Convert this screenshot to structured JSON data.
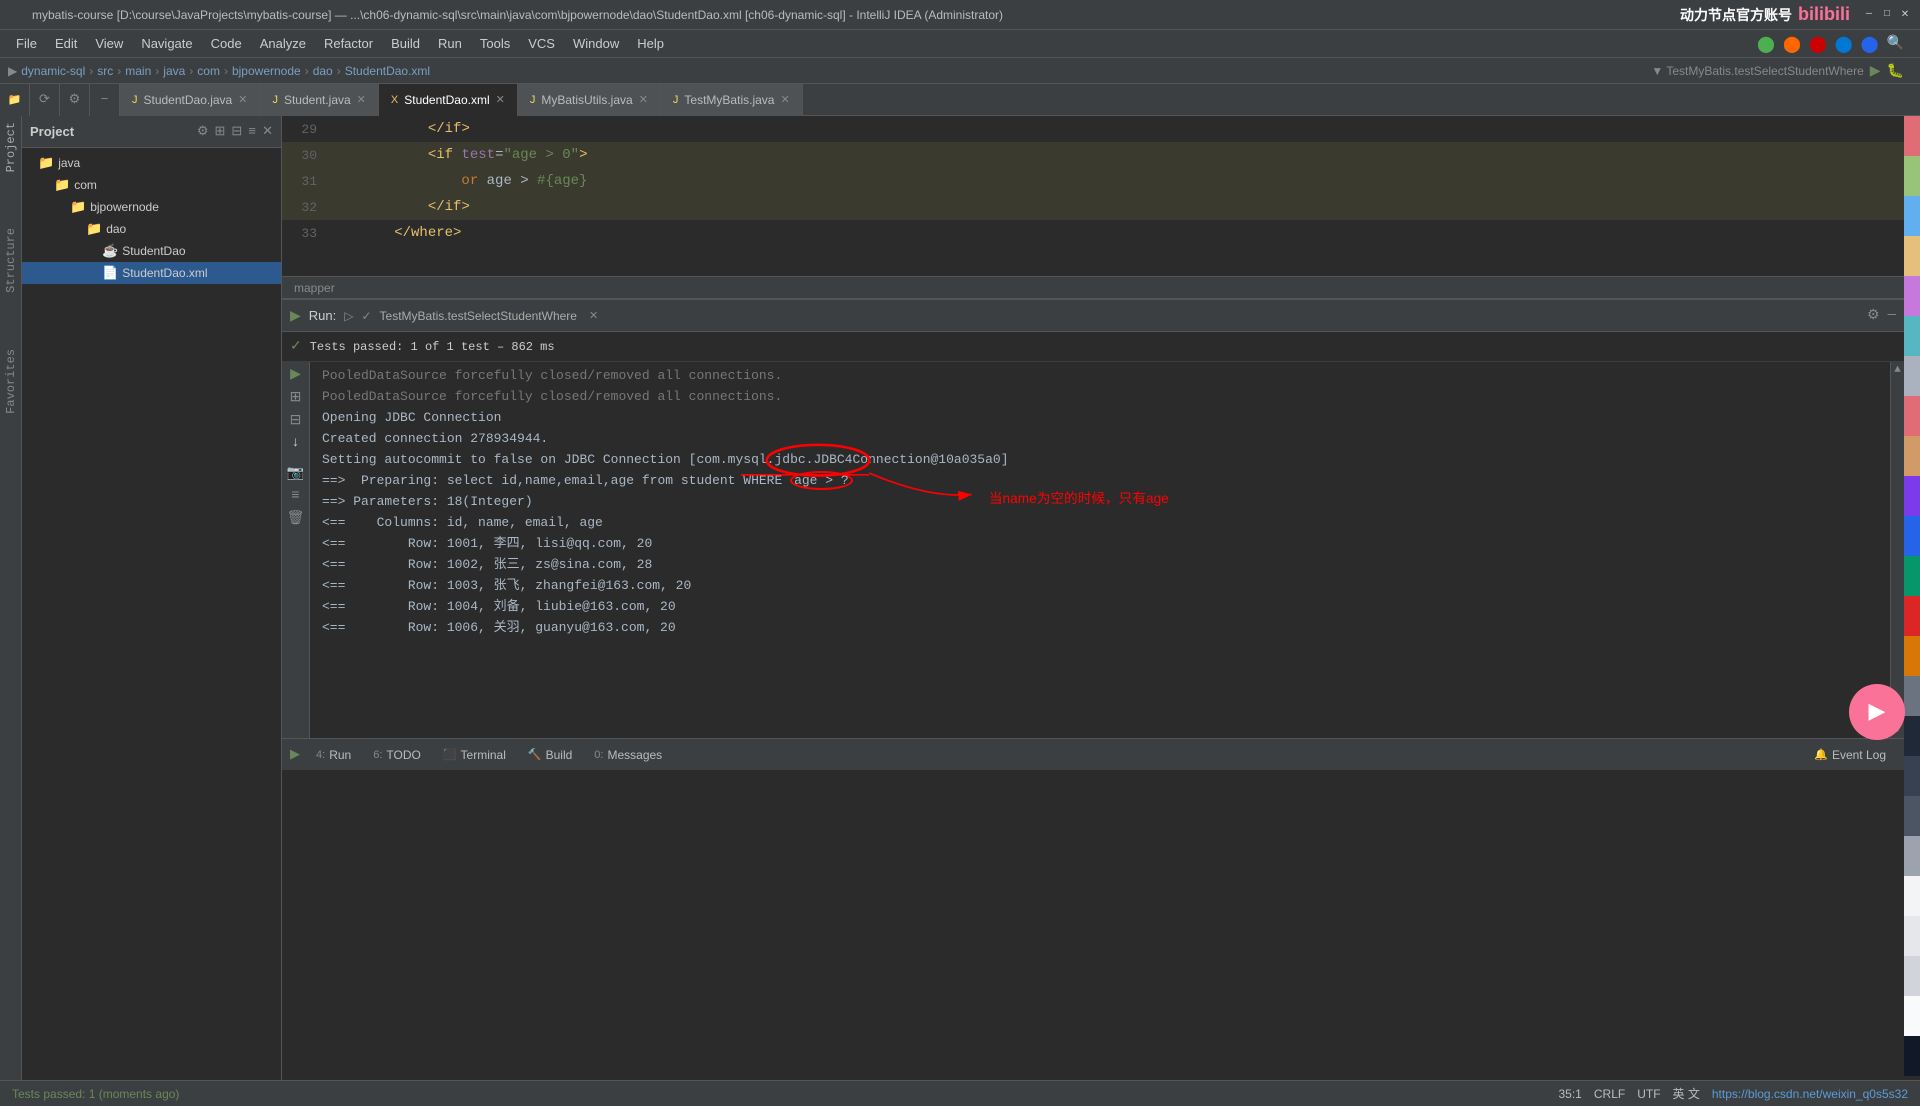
{
  "titlebar": {
    "title": "mybatis-course [D:\\course\\JavaProjects\\mybatis-course] — ...\\ch06-dynamic-sql\\src\\main\\java\\com\\bjpowernode\\dao\\StudentDao.xml [ch06-dynamic-sql] - IntelliJ IDEA (Administrator)",
    "bilibili_brand": "动力节点官方账号",
    "bilibili_logo": "bilibili"
  },
  "menubar": {
    "items": [
      "File",
      "Edit",
      "View",
      "Navigate",
      "Code",
      "Analyze",
      "Refactor",
      "Build",
      "Run",
      "Tools",
      "VCS",
      "Window",
      "Help"
    ]
  },
  "breadcrumb": {
    "items": [
      "dynamic-sql",
      "src",
      "main",
      "java",
      "com",
      "bjpowernode",
      "dao",
      "StudentDao.xml"
    ]
  },
  "tabs": [
    {
      "id": "studentdao-java",
      "label": "StudentDao.java",
      "active": false,
      "icon": "java"
    },
    {
      "id": "student-java",
      "label": "Student.java",
      "active": false,
      "icon": "java"
    },
    {
      "id": "studentdao-xml",
      "label": "StudentDao.xml",
      "active": true,
      "icon": "xml"
    },
    {
      "id": "mybatisutils-java",
      "label": "MyBatisUtils.java",
      "active": false,
      "icon": "java"
    },
    {
      "id": "testmybatis-java",
      "label": "TestMyBatis.java",
      "active": false,
      "icon": "java"
    }
  ],
  "editor": {
    "lines": [
      {
        "num": "29",
        "content": "            </if>"
      },
      {
        "num": "30",
        "content": "            <if test=\"age > 0\">"
      },
      {
        "num": "31",
        "content": "                or age > #{age}"
      },
      {
        "num": "32",
        "content": "            </if>"
      },
      {
        "num": "33",
        "content": "        </where>"
      }
    ],
    "mapper_breadcrumb": "mapper"
  },
  "run_panel": {
    "title": "Run:",
    "test_name": "TestMyBatis.testSelectStudentWhere",
    "close_label": "✕",
    "test_result": "Tests passed: 1 of 1 test – 862 ms",
    "console_lines": [
      "PooledDataSource forcefully closed/removed all connections.",
      "PooledDataSource forcefully closed/removed all connections.",
      "Opening JDBC Connection",
      "Created connection 278934944.",
      "Setting autocommit to false on JDBC Connection [com.mysql.jdbc.JDBC4Connection@10a035a0]",
      "==>  Preparing: select id,name,email,age from student WHERE age > ?",
      "==> Parameters: 18(Integer)",
      "<==    Columns: id, name, email, age",
      "<==        Row: 1001, 李四, lisi@qq.com, 20",
      "<==        Row: 1002, 张三, zs@sina.com, 28",
      "<==        Row: 1003, 张飞, zhangfei@163.com, 20",
      "<==        Row: 1004, 刘备, liubie@163.com, 20",
      "<==        Row: 1006, 关羽, guanyu@163.com, 20"
    ],
    "annotation_text": "当name为空的时候，只有age"
  },
  "status_bar": {
    "test_result": "Tests passed: 1 (moments ago)",
    "position": "35:1",
    "line_ending": "CRLF",
    "encoding": "UTF",
    "url": "https://blog.csdn.net/weixin_q0s5s32"
  },
  "bottom_tabs": [
    {
      "num": "4",
      "label": "Run"
    },
    {
      "num": "6",
      "label": "TODO"
    },
    {
      "label": "Terminal"
    },
    {
      "label": "Build"
    },
    {
      "num": "0",
      "label": "Messages"
    },
    {
      "label": "Event Log"
    }
  ]
}
